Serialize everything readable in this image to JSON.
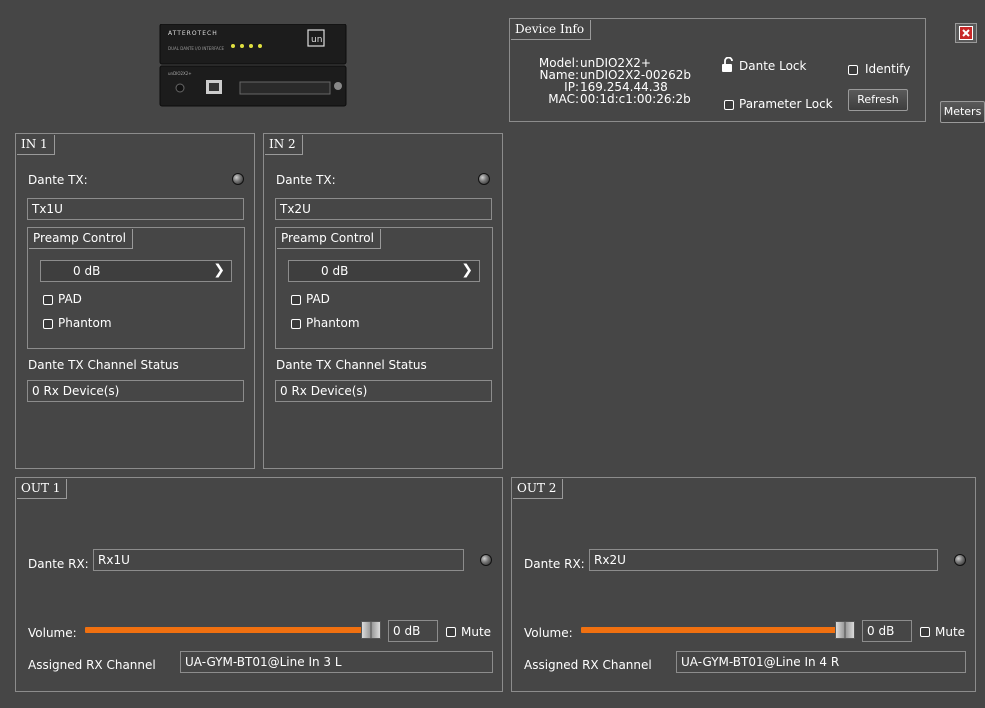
{
  "device_info": {
    "title": "Device Info",
    "model_label": "Model:",
    "model": "unDIO2X2+",
    "name_label": "Name:",
    "name": "unDIO2X2-00262b",
    "ip_label": "IP:",
    "ip": "169.254.44.38",
    "mac_label": "MAC:",
    "mac": "00:1d:c1:00:26:2b",
    "dante_lock": "Dante Lock",
    "identify": "Identify",
    "parameter_lock": "Parameter Lock",
    "refresh": "Refresh"
  },
  "window": {
    "meters": "Meters"
  },
  "inputs": [
    {
      "title": "IN 1",
      "dante_tx_label": "Dante TX:",
      "dante_tx": "Tx1U",
      "preamp_title": "Preamp Control",
      "gain": "0 dB",
      "pad": "PAD",
      "phantom": "Phantom",
      "status_label": "Dante TX Channel Status",
      "status": "0 Rx Device(s)"
    },
    {
      "title": "IN 2",
      "dante_tx_label": "Dante TX:",
      "dante_tx": "Tx2U",
      "preamp_title": "Preamp Control",
      "gain": "0 dB",
      "pad": "PAD",
      "phantom": "Phantom",
      "status_label": "Dante TX Channel Status",
      "status": "0 Rx Device(s)"
    }
  ],
  "outputs": [
    {
      "title": "OUT 1",
      "dante_rx_label": "Dante RX:",
      "dante_rx": "Rx1U",
      "volume_label": "Volume:",
      "volume": "0 dB",
      "volume_fraction": 1.0,
      "mute": "Mute",
      "assigned_label": "Assigned RX Channel",
      "assigned": "UA-GYM-BT01@Line In 3 L"
    },
    {
      "title": "OUT 2",
      "dante_rx_label": "Dante RX:",
      "dante_rx": "Rx2U",
      "volume_label": "Volume:",
      "volume": "0 dB",
      "volume_fraction": 1.0,
      "mute": "Mute",
      "assigned_label": "Assigned RX Channel",
      "assigned": "UA-GYM-BT01@Line In 4 R"
    }
  ],
  "colors": {
    "background": "#464646",
    "accent_orange": "#f07010",
    "close_red": "#c82828"
  },
  "device_image": {
    "brand": "ATTEROTECH",
    "model_label": "unDIO2X2+"
  }
}
